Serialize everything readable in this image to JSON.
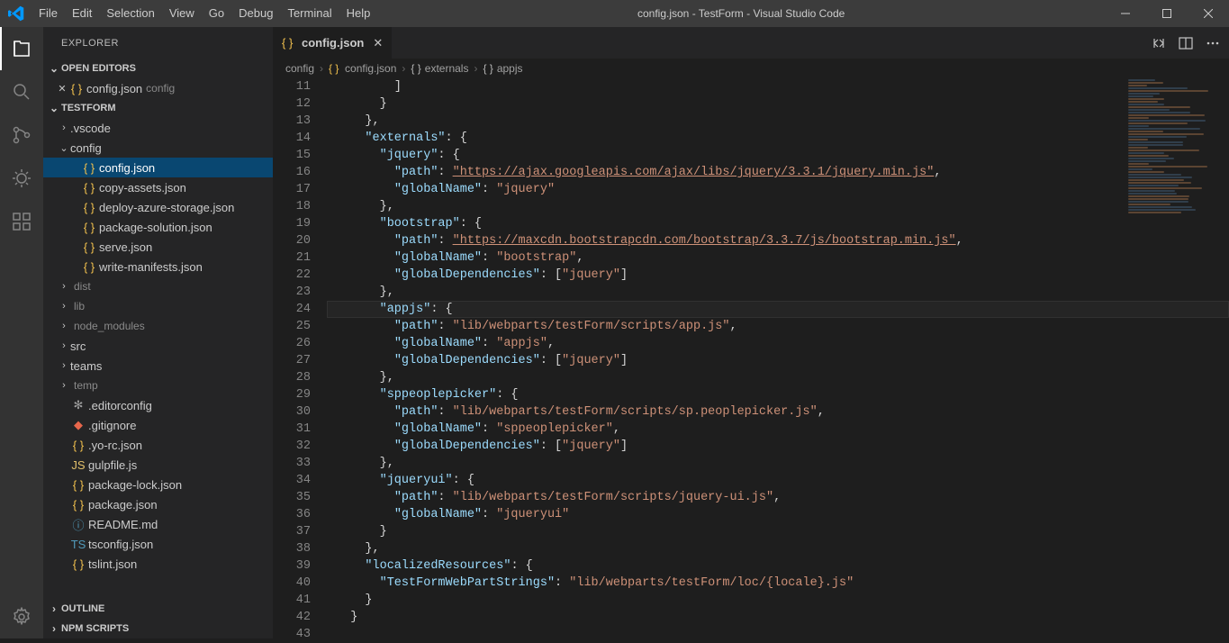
{
  "window": {
    "title": "config.json - TestForm - Visual Studio Code"
  },
  "menu": [
    "File",
    "Edit",
    "Selection",
    "View",
    "Go",
    "Debug",
    "Terminal",
    "Help"
  ],
  "explorer": {
    "title": "EXPLORER",
    "sections": {
      "openEditors": "OPEN EDITORS",
      "workspace": "TESTFORM",
      "outline": "OUTLINE",
      "npm": "NPM SCRIPTS"
    },
    "openEditor": {
      "file": "config.json",
      "folder": "config"
    },
    "tree": [
      {
        "type": "folder",
        "name": ".vscode",
        "depth": 1
      },
      {
        "type": "folder",
        "name": "config",
        "depth": 1,
        "expanded": true
      },
      {
        "type": "file",
        "name": "config.json",
        "icon": "json",
        "depth": 2,
        "selected": true
      },
      {
        "type": "file",
        "name": "copy-assets.json",
        "icon": "json",
        "depth": 2
      },
      {
        "type": "file",
        "name": "deploy-azure-storage.json",
        "icon": "json",
        "depth": 2
      },
      {
        "type": "file",
        "name": "package-solution.json",
        "icon": "json",
        "depth": 2
      },
      {
        "type": "file",
        "name": "serve.json",
        "icon": "json",
        "depth": 2
      },
      {
        "type": "file",
        "name": "write-manifests.json",
        "icon": "json",
        "depth": 2
      },
      {
        "type": "folder",
        "name": "dist",
        "depth": 1,
        "dim": true
      },
      {
        "type": "folder",
        "name": "lib",
        "depth": 1,
        "dim": true
      },
      {
        "type": "folder",
        "name": "node_modules",
        "depth": 1,
        "dim": true
      },
      {
        "type": "folder",
        "name": "src",
        "depth": 1
      },
      {
        "type": "folder",
        "name": "teams",
        "depth": 1
      },
      {
        "type": "folder",
        "name": "temp",
        "depth": 1,
        "dim": true
      },
      {
        "type": "file",
        "name": ".editorconfig",
        "icon": "gear",
        "depth": 1
      },
      {
        "type": "file",
        "name": ".gitignore",
        "icon": "git",
        "depth": 1
      },
      {
        "type": "file",
        "name": ".yo-rc.json",
        "icon": "json",
        "depth": 1
      },
      {
        "type": "file",
        "name": "gulpfile.js",
        "icon": "js",
        "depth": 1
      },
      {
        "type": "file",
        "name": "package-lock.json",
        "icon": "json",
        "depth": 1
      },
      {
        "type": "file",
        "name": "package.json",
        "icon": "json",
        "depth": 1
      },
      {
        "type": "file",
        "name": "README.md",
        "icon": "md",
        "depth": 1
      },
      {
        "type": "file",
        "name": "tsconfig.json",
        "icon": "ts",
        "depth": 1
      },
      {
        "type": "file",
        "name": "tslint.json",
        "icon": "json",
        "depth": 1
      }
    ]
  },
  "tab": {
    "label": "config.json"
  },
  "breadcrumb": [
    {
      "label": "config"
    },
    {
      "label": "config.json",
      "icon": "json"
    },
    {
      "label": "externals",
      "icon": "brace"
    },
    {
      "label": "appjs",
      "icon": "brace"
    }
  ],
  "lineStart": 11,
  "currentLine": 24,
  "code": [
    "        ]",
    "      }",
    "    },",
    "    \"externals\": {",
    "      \"jquery\": {",
    "        \"path\": \"https://ajax.googleapis.com/ajax/libs/jquery/3.3.1/jquery.min.js\",",
    "        \"globalName\": \"jquery\"",
    "      },",
    "      \"bootstrap\": {",
    "        \"path\": \"https://maxcdn.bootstrapcdn.com/bootstrap/3.3.7/js/bootstrap.min.js\",",
    "        \"globalName\": \"bootstrap\",",
    "        \"globalDependencies\": [\"jquery\"]",
    "      },",
    "      \"appjs\": {",
    "        \"path\": \"lib/webparts/testForm/scripts/app.js\",",
    "        \"globalName\": \"appjs\",",
    "        \"globalDependencies\": [\"jquery\"]",
    "      },",
    "      \"sppeoplepicker\": {",
    "        \"path\": \"lib/webparts/testForm/scripts/sp.peoplepicker.js\",",
    "        \"globalName\": \"sppeoplepicker\",",
    "        \"globalDependencies\": [\"jquery\"]",
    "      },",
    "      \"jqueryui\": {",
    "        \"path\": \"lib/webparts/testForm/scripts/jquery-ui.js\",",
    "        \"globalName\": \"jqueryui\"",
    "      }",
    "    },",
    "    \"localizedResources\": {",
    "      \"TestFormWebPartStrings\": \"lib/webparts/testForm/loc/{locale}.js\"",
    "    }",
    "  }",
    ""
  ]
}
